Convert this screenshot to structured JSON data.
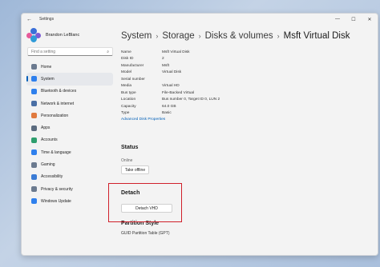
{
  "window": {
    "app_title": "Settings",
    "back_icon": "back-arrow-icon",
    "controls": [
      "—",
      "☐",
      "✕"
    ]
  },
  "profile": {
    "name": "Brandon LeBlanc"
  },
  "search": {
    "placeholder": "Find a setting"
  },
  "nav": [
    {
      "label": "Home",
      "color": "#6b7a8f",
      "active": false
    },
    {
      "label": "System",
      "color": "#2f80ed",
      "active": true
    },
    {
      "label": "Bluetooth & devices",
      "color": "#2f80ed",
      "active": false
    },
    {
      "label": "Network & internet",
      "color": "#4a6fa5",
      "active": false
    },
    {
      "label": "Personalization",
      "color": "#e07a3f",
      "active": false
    },
    {
      "label": "Apps",
      "color": "#5b6b7f",
      "active": false
    },
    {
      "label": "Accounts",
      "color": "#2e9e6e",
      "active": false
    },
    {
      "label": "Time & language",
      "color": "#2f80ed",
      "active": false
    },
    {
      "label": "Gaming",
      "color": "#6b7a8f",
      "active": false
    },
    {
      "label": "Accessibility",
      "color": "#3a7bd5",
      "active": false
    },
    {
      "label": "Privacy & security",
      "color": "#6b7a8f",
      "active": false
    },
    {
      "label": "Windows Update",
      "color": "#2f80ed",
      "active": false
    }
  ],
  "breadcrumb": {
    "items": [
      "System",
      "Storage",
      "Disks & volumes"
    ],
    "current": "Msft Virtual Disk",
    "separator": "›"
  },
  "properties": [
    {
      "key": "Name",
      "value": "Msft Virtual Disk"
    },
    {
      "key": "Disk ID",
      "value": "2"
    },
    {
      "key": "Manufacturer",
      "value": "Msft"
    },
    {
      "key": "Model",
      "value": "Virtual Disk"
    },
    {
      "key": "Serial number",
      "value": ""
    },
    {
      "key": "Media",
      "value": "Virtual HD"
    },
    {
      "key": "Bus type",
      "value": "File-Backed Virtual"
    },
    {
      "key": "Location",
      "value": "Bus number 0, Target ID 0, LUN 2"
    },
    {
      "key": "Capacity",
      "value": "64.0 GB"
    },
    {
      "key": "Type",
      "value": "Basic"
    }
  ],
  "advanced_link": "Advanced Disk Properties",
  "status": {
    "title": "Status",
    "text": "Online",
    "button": "Take offline"
  },
  "detach": {
    "title": "Detach",
    "button": "Detach VHD"
  },
  "partition": {
    "title": "Partition Style",
    "text": "GUID Partition Table (GPT)"
  }
}
